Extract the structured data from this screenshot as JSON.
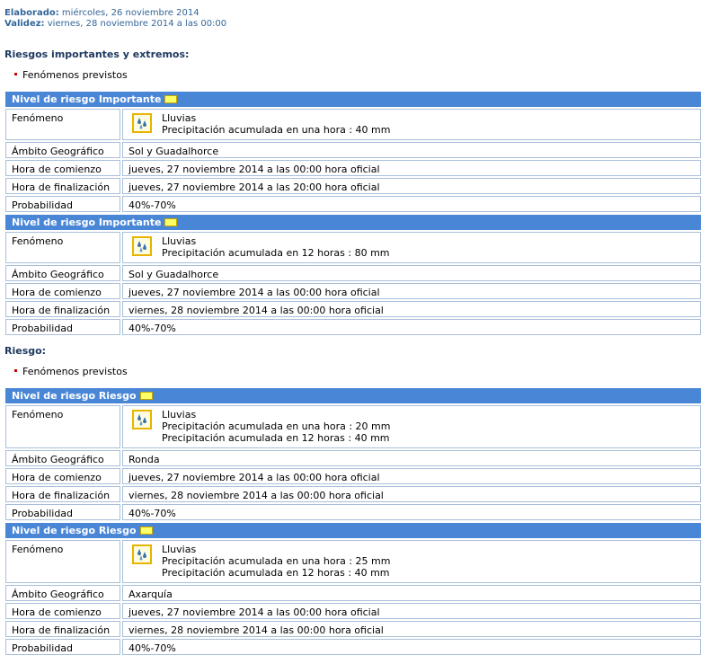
{
  "meta": {
    "elaborado_label": "Elaborado:",
    "elaborado_value": " miércoles, 26 noviembre 2014",
    "validez_label": "Validez:",
    "validez_value": " viernes, 28 noviembre 2014 a las 00:00"
  },
  "labels": {
    "fenomeno": "Fenómeno",
    "ambito": "Ámbito Geográfico",
    "comienzo": "Hora de comienzo",
    "finalizacion": "Hora de finalización",
    "probabilidad": "Probabilidad"
  },
  "colors": {
    "header_bg": "#4a86d6",
    "level_yellow": "#ffff66",
    "title_text": "#1f3a60",
    "meta_text": "#336699"
  },
  "icon": "rain-icon",
  "sections": [
    {
      "title": "Riesgos importantes y extremos:",
      "bullet": "Fenómenos previstos",
      "warnings": [
        {
          "header": "Nivel de riesgo Importante",
          "phenomenon": "Lluvias",
          "details": [
            "Precipitación acumulada en una hora : 40 mm"
          ],
          "area": "Sol y Guadalhorce",
          "start": "jueves, 27 noviembre 2014 a las 00:00 hora oficial",
          "end": "jueves, 27 noviembre 2014 a las 20:00 hora oficial",
          "probability": "40%-70%"
        },
        {
          "header": "Nivel de riesgo Importante",
          "phenomenon": "Lluvias",
          "details": [
            "Precipitación acumulada en 12 horas : 80 mm"
          ],
          "area": "Sol y Guadalhorce",
          "start": "jueves, 27 noviembre 2014 a las 00:00 hora oficial",
          "end": "viernes, 28 noviembre 2014 a las 00:00 hora oficial",
          "probability": "40%-70%"
        }
      ]
    },
    {
      "title": "Riesgo:",
      "bullet": "Fenómenos previstos",
      "warnings": [
        {
          "header": "Nivel de riesgo Riesgo",
          "phenomenon": "Lluvias",
          "details": [
            "Precipitación acumulada en una hora : 20 mm",
            "Precipitación acumulada en 12 horas : 40 mm"
          ],
          "area": "Ronda",
          "start": "jueves, 27 noviembre 2014 a las 00:00 hora oficial",
          "end": "viernes, 28 noviembre 2014 a las 00:00 hora oficial",
          "probability": "40%-70%"
        },
        {
          "header": "Nivel de riesgo Riesgo",
          "phenomenon": "Lluvias",
          "details": [
            "Precipitación acumulada en una hora : 25 mm",
            "Precipitación acumulada en 12 horas : 40 mm"
          ],
          "area": "Axarquía",
          "start": "jueves, 27 noviembre 2014 a las 00:00 hora oficial",
          "end": "viernes, 28 noviembre 2014 a las 00:00 hora oficial",
          "probability": "40%-70%"
        }
      ]
    }
  ]
}
